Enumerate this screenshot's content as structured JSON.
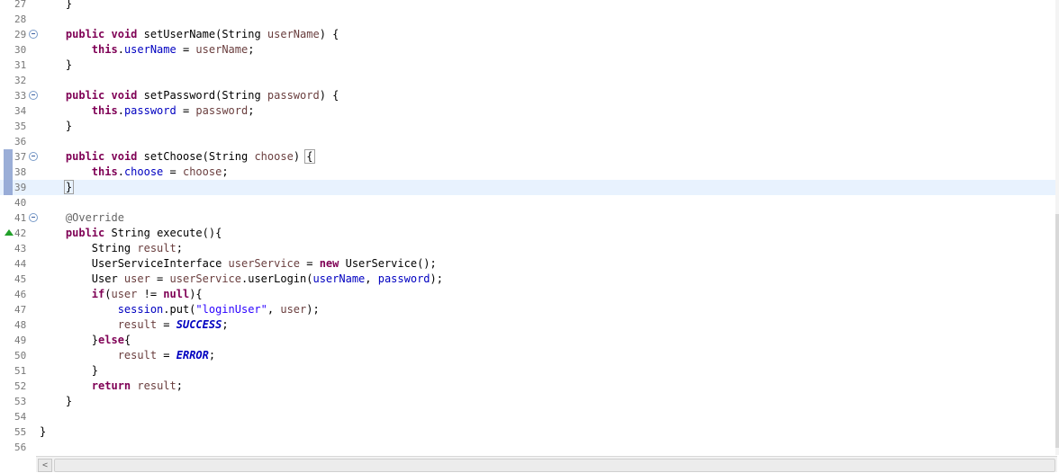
{
  "editor": {
    "current_line": "39",
    "lines": [
      {
        "n": "27",
        "segs": [
          {
            "t": "    }",
            "c": ""
          }
        ]
      },
      {
        "n": "28",
        "segs": []
      },
      {
        "n": "29",
        "fold": true,
        "segs": [
          {
            "t": "    ",
            "c": ""
          },
          {
            "t": "public",
            "c": "kw"
          },
          {
            "t": " ",
            "c": ""
          },
          {
            "t": "void",
            "c": "kw"
          },
          {
            "t": " setUserName(String ",
            "c": ""
          },
          {
            "t": "userName",
            "c": "param"
          },
          {
            "t": ") {",
            "c": ""
          }
        ]
      },
      {
        "n": "30",
        "segs": [
          {
            "t": "        ",
            "c": ""
          },
          {
            "t": "this",
            "c": "kw"
          },
          {
            "t": ".",
            "c": ""
          },
          {
            "t": "userName",
            "c": "fld"
          },
          {
            "t": " = ",
            "c": ""
          },
          {
            "t": "userName",
            "c": "param"
          },
          {
            "t": ";",
            "c": ""
          }
        ]
      },
      {
        "n": "31",
        "segs": [
          {
            "t": "    }",
            "c": ""
          }
        ]
      },
      {
        "n": "32",
        "segs": []
      },
      {
        "n": "33",
        "fold": true,
        "segs": [
          {
            "t": "    ",
            "c": ""
          },
          {
            "t": "public",
            "c": "kw"
          },
          {
            "t": " ",
            "c": ""
          },
          {
            "t": "void",
            "c": "kw"
          },
          {
            "t": " setPassword(String ",
            "c": ""
          },
          {
            "t": "password",
            "c": "param"
          },
          {
            "t": ") {",
            "c": ""
          }
        ]
      },
      {
        "n": "34",
        "segs": [
          {
            "t": "        ",
            "c": ""
          },
          {
            "t": "this",
            "c": "kw"
          },
          {
            "t": ".",
            "c": ""
          },
          {
            "t": "password",
            "c": "fld"
          },
          {
            "t": " = ",
            "c": ""
          },
          {
            "t": "password",
            "c": "param"
          },
          {
            "t": ";",
            "c": ""
          }
        ]
      },
      {
        "n": "35",
        "segs": [
          {
            "t": "    }",
            "c": ""
          }
        ]
      },
      {
        "n": "36",
        "segs": []
      },
      {
        "n": "37",
        "fold": true,
        "marker": true,
        "segs": [
          {
            "t": "    ",
            "c": ""
          },
          {
            "t": "public",
            "c": "kw"
          },
          {
            "t": " ",
            "c": ""
          },
          {
            "t": "void",
            "c": "kw"
          },
          {
            "t": " setChoose(String ",
            "c": ""
          },
          {
            "t": "choose",
            "c": "param"
          },
          {
            "t": ") ",
            "c": ""
          },
          {
            "t": "{",
            "c": "bracket-box"
          }
        ]
      },
      {
        "n": "38",
        "marker": true,
        "segs": [
          {
            "t": "        ",
            "c": ""
          },
          {
            "t": "this",
            "c": "kw"
          },
          {
            "t": ".",
            "c": ""
          },
          {
            "t": "choose",
            "c": "fld"
          },
          {
            "t": " = ",
            "c": ""
          },
          {
            "t": "choose",
            "c": "param"
          },
          {
            "t": ";",
            "c": ""
          }
        ]
      },
      {
        "n": "39",
        "marker": true,
        "segs": [
          {
            "t": "    ",
            "c": ""
          },
          {
            "t": "}",
            "c": "bracket-box"
          }
        ]
      },
      {
        "n": "40",
        "segs": []
      },
      {
        "n": "41",
        "fold": true,
        "segs": [
          {
            "t": "    ",
            "c": ""
          },
          {
            "t": "@Override",
            "c": "ann"
          }
        ]
      },
      {
        "n": "42",
        "override": true,
        "segs": [
          {
            "t": "    ",
            "c": ""
          },
          {
            "t": "public",
            "c": "kw"
          },
          {
            "t": " String execute(){",
            "c": ""
          }
        ]
      },
      {
        "n": "43",
        "segs": [
          {
            "t": "        String ",
            "c": ""
          },
          {
            "t": "result",
            "c": "param"
          },
          {
            "t": ";",
            "c": ""
          }
        ]
      },
      {
        "n": "44",
        "segs": [
          {
            "t": "        UserServiceInterface ",
            "c": ""
          },
          {
            "t": "userService",
            "c": "param"
          },
          {
            "t": " = ",
            "c": ""
          },
          {
            "t": "new",
            "c": "kw"
          },
          {
            "t": " UserService();",
            "c": ""
          }
        ]
      },
      {
        "n": "45",
        "segs": [
          {
            "t": "        User ",
            "c": ""
          },
          {
            "t": "user",
            "c": "param"
          },
          {
            "t": " = ",
            "c": ""
          },
          {
            "t": "userService",
            "c": "param"
          },
          {
            "t": ".userLogin(",
            "c": ""
          },
          {
            "t": "userName",
            "c": "fld"
          },
          {
            "t": ", ",
            "c": ""
          },
          {
            "t": "password",
            "c": "fld"
          },
          {
            "t": ");",
            "c": ""
          }
        ]
      },
      {
        "n": "46",
        "segs": [
          {
            "t": "        ",
            "c": ""
          },
          {
            "t": "if",
            "c": "kw"
          },
          {
            "t": "(",
            "c": ""
          },
          {
            "t": "user",
            "c": "param"
          },
          {
            "t": " != ",
            "c": ""
          },
          {
            "t": "null",
            "c": "kw"
          },
          {
            "t": "){",
            "c": ""
          }
        ]
      },
      {
        "n": "47",
        "segs": [
          {
            "t": "            ",
            "c": ""
          },
          {
            "t": "session",
            "c": "fld"
          },
          {
            "t": ".put(",
            "c": ""
          },
          {
            "t": "\"loginUser\"",
            "c": "str"
          },
          {
            "t": ", ",
            "c": ""
          },
          {
            "t": "user",
            "c": "param"
          },
          {
            "t": ");",
            "c": ""
          }
        ]
      },
      {
        "n": "48",
        "segs": [
          {
            "t": "            ",
            "c": ""
          },
          {
            "t": "result",
            "c": "param"
          },
          {
            "t": " = ",
            "c": ""
          },
          {
            "t": "SUCCESS",
            "c": "const"
          },
          {
            "t": ";",
            "c": ""
          }
        ]
      },
      {
        "n": "49",
        "segs": [
          {
            "t": "        }",
            "c": ""
          },
          {
            "t": "else",
            "c": "kw"
          },
          {
            "t": "{",
            "c": ""
          }
        ]
      },
      {
        "n": "50",
        "segs": [
          {
            "t": "            ",
            "c": ""
          },
          {
            "t": "result",
            "c": "param"
          },
          {
            "t": " = ",
            "c": ""
          },
          {
            "t": "ERROR",
            "c": "const"
          },
          {
            "t": ";",
            "c": ""
          }
        ]
      },
      {
        "n": "51",
        "segs": [
          {
            "t": "        }",
            "c": ""
          }
        ]
      },
      {
        "n": "52",
        "segs": [
          {
            "t": "        ",
            "c": ""
          },
          {
            "t": "return",
            "c": "kw"
          },
          {
            "t": " ",
            "c": ""
          },
          {
            "t": "result",
            "c": "param"
          },
          {
            "t": ";",
            "c": ""
          }
        ]
      },
      {
        "n": "53",
        "segs": [
          {
            "t": "    }",
            "c": ""
          }
        ]
      },
      {
        "n": "54",
        "segs": []
      },
      {
        "n": "55",
        "segs": [
          {
            "t": "}",
            "c": ""
          }
        ]
      },
      {
        "n": "56",
        "segs": []
      }
    ]
  },
  "scrollbar": {
    "left_arrow": "<"
  }
}
